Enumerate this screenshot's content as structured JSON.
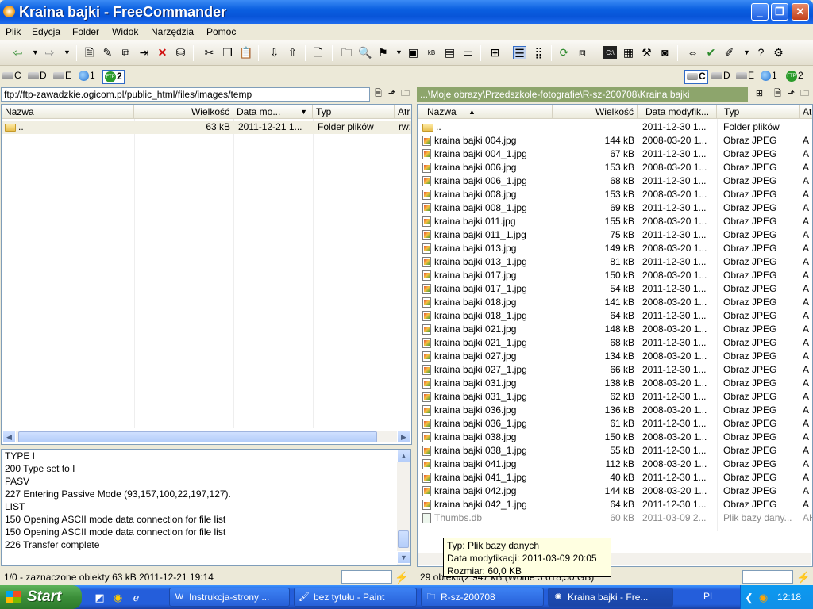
{
  "window": {
    "title": "Kraina bajki - FreeCommander"
  },
  "menu": [
    "Plik",
    "Edycja",
    "Folder",
    "Widok",
    "Narzędzia",
    "Pomoc"
  ],
  "drives_left": [
    "C",
    "D",
    "E",
    "1",
    "2"
  ],
  "drives_right": [
    "C",
    "D",
    "E",
    "1",
    "2"
  ],
  "left": {
    "path": "ftp://ftp-zawadzkie.ogicom.pl/public_html/files/images/temp",
    "headers": [
      "Nazwa",
      "Wielkość",
      "Data mo...",
      "Typ",
      "Atr"
    ],
    "rows": [
      {
        "name": "..",
        "size": "63 kB",
        "date": "2011-12-21 1...",
        "type": "Folder plików",
        "attr": "rw:"
      }
    ]
  },
  "right": {
    "path": "...\\Moje obrazy\\Przedszkole-fotografie\\R-sz-200708\\Kraina bajki",
    "headers": [
      "Nazwa",
      "Wielkość",
      "Data modyfik...",
      "Typ",
      "At"
    ],
    "rows": [
      {
        "name": "..",
        "size": "",
        "date": "2011-12-30 1...",
        "type": "Folder plików",
        "attr": ""
      },
      {
        "name": "kraina bajki 004.jpg",
        "size": "144 kB",
        "date": "2008-03-20 1...",
        "type": "Obraz JPEG",
        "attr": "A"
      },
      {
        "name": "kraina bajki 004_1.jpg",
        "size": "67 kB",
        "date": "2011-12-30 1...",
        "type": "Obraz JPEG",
        "attr": "A"
      },
      {
        "name": "kraina bajki 006.jpg",
        "size": "153 kB",
        "date": "2008-03-20 1...",
        "type": "Obraz JPEG",
        "attr": "A"
      },
      {
        "name": "kraina bajki 006_1.jpg",
        "size": "68 kB",
        "date": "2011-12-30 1...",
        "type": "Obraz JPEG",
        "attr": "A"
      },
      {
        "name": "kraina bajki 008.jpg",
        "size": "153 kB",
        "date": "2008-03-20 1...",
        "type": "Obraz JPEG",
        "attr": "A"
      },
      {
        "name": "kraina bajki 008_1.jpg",
        "size": "69 kB",
        "date": "2011-12-30 1...",
        "type": "Obraz JPEG",
        "attr": "A"
      },
      {
        "name": "kraina bajki 011.jpg",
        "size": "155 kB",
        "date": "2008-03-20 1...",
        "type": "Obraz JPEG",
        "attr": "A"
      },
      {
        "name": "kraina bajki 011_1.jpg",
        "size": "75 kB",
        "date": "2011-12-30 1...",
        "type": "Obraz JPEG",
        "attr": "A"
      },
      {
        "name": "kraina bajki 013.jpg",
        "size": "149 kB",
        "date": "2008-03-20 1...",
        "type": "Obraz JPEG",
        "attr": "A"
      },
      {
        "name": "kraina bajki 013_1.jpg",
        "size": "81 kB",
        "date": "2011-12-30 1...",
        "type": "Obraz JPEG",
        "attr": "A"
      },
      {
        "name": "kraina bajki 017.jpg",
        "size": "150 kB",
        "date": "2008-03-20 1...",
        "type": "Obraz JPEG",
        "attr": "A"
      },
      {
        "name": "kraina bajki 017_1.jpg",
        "size": "54 kB",
        "date": "2011-12-30 1...",
        "type": "Obraz JPEG",
        "attr": "A"
      },
      {
        "name": "kraina bajki 018.jpg",
        "size": "141 kB",
        "date": "2008-03-20 1...",
        "type": "Obraz JPEG",
        "attr": "A"
      },
      {
        "name": "kraina bajki 018_1.jpg",
        "size": "64 kB",
        "date": "2011-12-30 1...",
        "type": "Obraz JPEG",
        "attr": "A"
      },
      {
        "name": "kraina bajki 021.jpg",
        "size": "148 kB",
        "date": "2008-03-20 1...",
        "type": "Obraz JPEG",
        "attr": "A"
      },
      {
        "name": "kraina bajki 021_1.jpg",
        "size": "68 kB",
        "date": "2011-12-30 1...",
        "type": "Obraz JPEG",
        "attr": "A"
      },
      {
        "name": "kraina bajki 027.jpg",
        "size": "134 kB",
        "date": "2008-03-20 1...",
        "type": "Obraz JPEG",
        "attr": "A"
      },
      {
        "name": "kraina bajki 027_1.jpg",
        "size": "66 kB",
        "date": "2011-12-30 1...",
        "type": "Obraz JPEG",
        "attr": "A"
      },
      {
        "name": "kraina bajki 031.jpg",
        "size": "138 kB",
        "date": "2008-03-20 1...",
        "type": "Obraz JPEG",
        "attr": "A"
      },
      {
        "name": "kraina bajki 031_1.jpg",
        "size": "62 kB",
        "date": "2011-12-30 1...",
        "type": "Obraz JPEG",
        "attr": "A"
      },
      {
        "name": "kraina bajki 036.jpg",
        "size": "136 kB",
        "date": "2008-03-20 1...",
        "type": "Obraz JPEG",
        "attr": "A"
      },
      {
        "name": "kraina bajki 036_1.jpg",
        "size": "61 kB",
        "date": "2011-12-30 1...",
        "type": "Obraz JPEG",
        "attr": "A"
      },
      {
        "name": "kraina bajki 038.jpg",
        "size": "150 kB",
        "date": "2008-03-20 1...",
        "type": "Obraz JPEG",
        "attr": "A"
      },
      {
        "name": "kraina bajki 038_1.jpg",
        "size": "55 kB",
        "date": "2011-12-30 1...",
        "type": "Obraz JPEG",
        "attr": "A"
      },
      {
        "name": "kraina bajki 041.jpg",
        "size": "112 kB",
        "date": "2008-03-20 1...",
        "type": "Obraz JPEG",
        "attr": "A"
      },
      {
        "name": "kraina bajki 041_1.jpg",
        "size": "40 kB",
        "date": "2011-12-30 1...",
        "type": "Obraz JPEG",
        "attr": "A"
      },
      {
        "name": "kraina bajki 042.jpg",
        "size": "144 kB",
        "date": "2008-03-20 1...",
        "type": "Obraz JPEG",
        "attr": "A"
      },
      {
        "name": "kraina bajki 042_1.jpg",
        "size": "64 kB",
        "date": "2011-12-30 1...",
        "type": "Obraz JPEG",
        "attr": "A"
      },
      {
        "name": "Thumbs.db",
        "size": "60 kB",
        "date": "2011-03-09 2...",
        "type": "Plik bazy dany...",
        "attr": "AH"
      }
    ]
  },
  "log": [
    "TYPE I",
    "200 Type set to I",
    "PASV",
    "227 Entering Passive Mode (93,157,100,22,197,127).",
    "LIST",
    "150 Opening ASCII mode data connection for file list",
    "150 Opening ASCII mode data connection for file list",
    "226 Transfer complete"
  ],
  "status": {
    "left": "1/0 - zaznaczone obiekty   63 kB  2011-12-21 19:14",
    "right": "29 obiekt/(2 947 kB   (Wolne 3 618,50 GB)"
  },
  "tooltip": {
    "line1": "Typ: Plik bazy danych",
    "line2": "Data modyfikacji: 2011-03-09 20:05",
    "line3": "Rozmiar: 60,0 KB"
  },
  "taskbar": {
    "start": "Start",
    "items": [
      "Instrukcja-strony ...",
      "bez tytułu - Paint",
      "R-sz-200708",
      "Kraina bajki - Fre..."
    ],
    "lang": "PL",
    "clock": "12:18"
  }
}
